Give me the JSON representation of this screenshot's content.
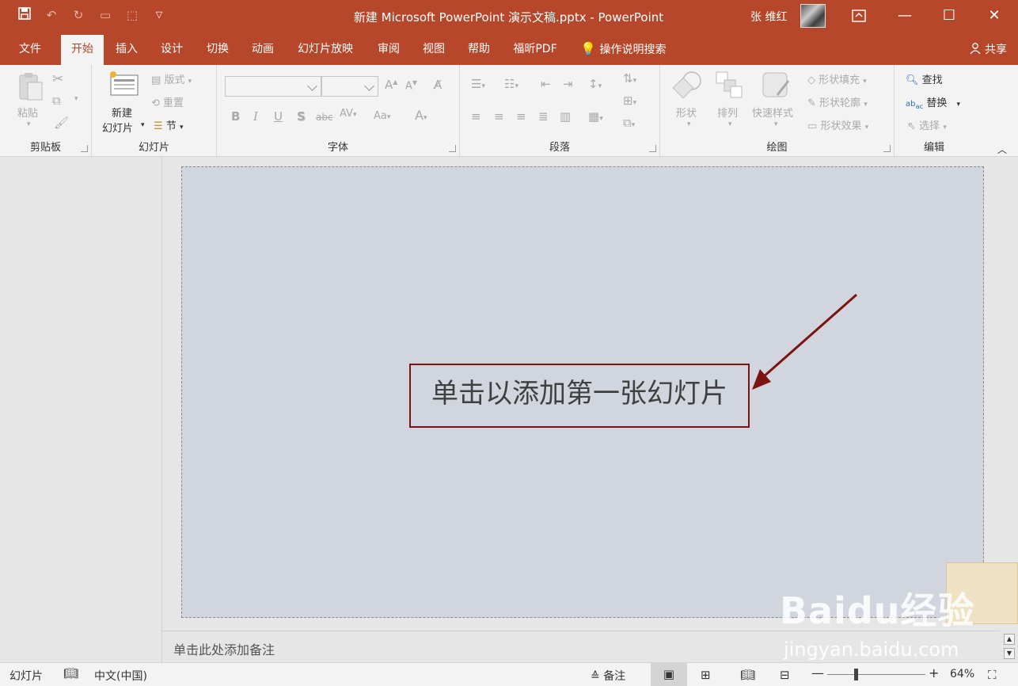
{
  "window": {
    "title": "新建 Microsoft PowerPoint 演示文稿.pptx  -  PowerPoint",
    "user": "张 维红"
  },
  "tabs": [
    "文件",
    "开始",
    "插入",
    "设计",
    "切换",
    "动画",
    "幻灯片放映",
    "审阅",
    "视图",
    "帮助",
    "福昕PDF"
  ],
  "active_tab": "开始",
  "tell_me": "操作说明搜索",
  "share": "共享",
  "ribbon": {
    "clipboard": {
      "label": "剪贴板",
      "paste": "粘贴"
    },
    "slides": {
      "label": "幻灯片",
      "new_slide_1": "新建",
      "new_slide_2": "幻灯片",
      "layout": "版式",
      "reset": "重置",
      "section": "节"
    },
    "font": {
      "label": "字体",
      "font_name": "",
      "font_size": ""
    },
    "paragraph": {
      "label": "段落"
    },
    "drawing": {
      "label": "绘图",
      "shapes": "形状",
      "arrange": "排列",
      "quick_styles": "快速样式",
      "shape_fill": "形状填充",
      "shape_outline": "形状轮廓",
      "shape_effects": "形状效果"
    },
    "editing": {
      "label": "编辑",
      "find": "查找",
      "replace": "替换",
      "select": "选择"
    }
  },
  "slide": {
    "placeholder": "单击以添加第一张幻灯片"
  },
  "notes_placeholder": "单击此处添加备注",
  "statusbar": {
    "view": "幻灯片",
    "language": "中文(中国)",
    "notes": "备注",
    "zoom": "64%"
  },
  "watermark": {
    "brand": "Baidu经验",
    "url": "jingyan.baidu.com"
  },
  "colors": {
    "accent": "#b7472a",
    "annotation": "#7b1313"
  }
}
